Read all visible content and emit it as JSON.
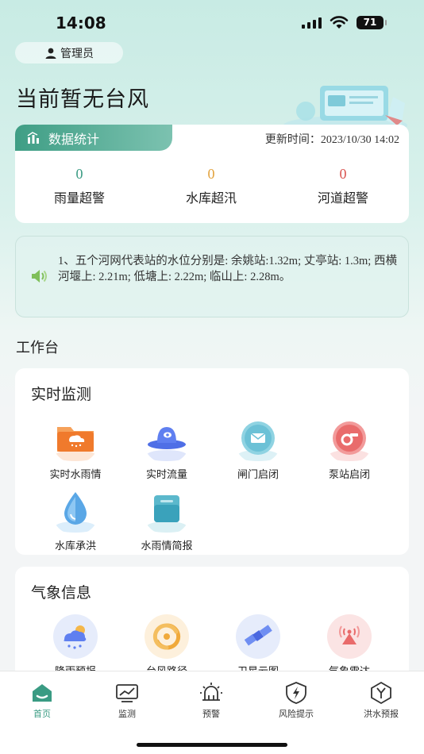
{
  "status": {
    "time": "14:08",
    "battery": "71"
  },
  "user": {
    "role": "管理员"
  },
  "header": {
    "title": "当前暂无台风"
  },
  "stats": {
    "tab_label": "数据统计",
    "update_label": "更新时间：",
    "update_time": "2023/10/30 14:02",
    "items": [
      {
        "value": "0",
        "label": "雨量超警",
        "color": "#3a9b83"
      },
      {
        "value": "0",
        "label": "水库超汛",
        "color": "#e2a23c"
      },
      {
        "value": "0",
        "label": "河道超警",
        "color": "#d9534f"
      }
    ]
  },
  "notice": {
    "text": "1、五个河网代表站的水位分别是: 余姚站:1.32m; 丈亭站: 1.3m; 西横河堰上: 2.21m; 低塘上: 2.22m; 临山上: 2.28m。"
  },
  "workbench": {
    "title": "工作台"
  },
  "monitoring": {
    "title": "实时监测",
    "items": [
      {
        "label": "实时水雨情",
        "icon": "folder-rain-icon"
      },
      {
        "label": "实时流量",
        "icon": "flow-icon"
      },
      {
        "label": "闸门启闭",
        "icon": "gate-icon"
      },
      {
        "label": "泵站启闭",
        "icon": "pump-icon"
      },
      {
        "label": "水库承洪",
        "icon": "reservoir-icon"
      },
      {
        "label": "水雨情简报",
        "icon": "report-icon"
      }
    ]
  },
  "weather": {
    "title": "气象信息",
    "items": [
      {
        "label": "降雨预报",
        "icon": "rain-forecast-icon"
      },
      {
        "label": "台风路径",
        "icon": "typhoon-icon"
      },
      {
        "label": "卫星云图",
        "icon": "satellite-icon"
      },
      {
        "label": "气象雷达",
        "icon": "radar-icon"
      }
    ]
  },
  "tabs": [
    {
      "label": "首页",
      "icon": "home-icon",
      "active": true
    },
    {
      "label": "监测",
      "icon": "monitor-icon"
    },
    {
      "label": "预警",
      "icon": "warning-icon"
    },
    {
      "label": "风险提示",
      "icon": "risk-icon"
    },
    {
      "label": "洪水预报",
      "icon": "flood-forecast-icon"
    }
  ]
}
